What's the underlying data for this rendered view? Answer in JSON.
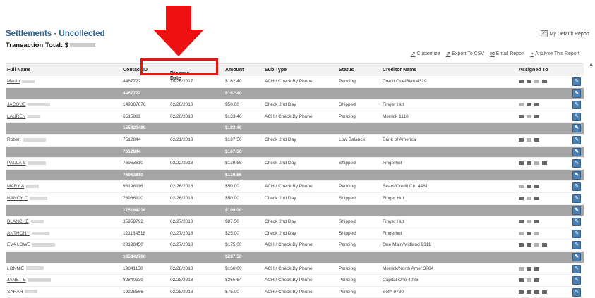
{
  "header": {
    "title": "Settlements - Uncollected",
    "total_label": "Transaction Total: $",
    "my_default_report": "My Default Report",
    "my_default_checked": true
  },
  "toolbar": {
    "customize": "Customize",
    "export_csv": "Export To CSV",
    "email_report": "Email Report",
    "analyze_report": "Analyze This Report"
  },
  "columns": {
    "full_name": "Full Name",
    "contact_id": "Contact ID",
    "process_date": "Process Date",
    "amount": "Amount",
    "sub_type": "Sub Type",
    "status": "Status",
    "creditor_name": "Creditor Name",
    "assigned_to": "Assigned To"
  },
  "rows": [
    {
      "type": "data",
      "name": "Martin",
      "contact": "4467722",
      "date": "10/26/2017",
      "amount": "$162.40",
      "sub": "ACH / Check By Phone",
      "status": "Pending",
      "creditor": "Credit One/Blatt 4329"
    },
    {
      "type": "sub",
      "contact": "4467722",
      "amount": "$162.40"
    },
    {
      "type": "data",
      "name": "JACQUE",
      "contact": "149307878",
      "date": "02/20/2018",
      "amount": "$50.00",
      "sub": "Check 2nd Day",
      "status": "Shipped",
      "creditor": "Finger Hut"
    },
    {
      "type": "data",
      "name": "LAUREN",
      "contact": "6515811",
      "date": "02/20/2018",
      "amount": "$133.46",
      "sub": "ACH / Check By Phone",
      "status": "Pending",
      "creditor": "Merrick 1110"
    },
    {
      "type": "sub",
      "contact": "155823489",
      "amount": "$183.46"
    },
    {
      "type": "data",
      "name": "Robert",
      "contact": "7512844",
      "date": "02/21/2018",
      "amount": "$187.50",
      "sub": "Check 2nd Day",
      "status": "Low Balance",
      "creditor": "Bank of America"
    },
    {
      "type": "sub",
      "contact": "7512844",
      "amount": "$187.50"
    },
    {
      "type": "data",
      "name": "PAULA S",
      "contact": "76963810",
      "date": "02/22/2018",
      "amount": "$139.66",
      "sub": "Check 2nd Day",
      "status": "Shipped",
      "creditor": "Fingerhut"
    },
    {
      "type": "sub",
      "contact": "76963810",
      "amount": "$139.66"
    },
    {
      "type": "data",
      "name": "MARY A",
      "contact": "98198116",
      "date": "02/26/2018",
      "amount": "$50.00",
      "sub": "ACH / Check By Phone",
      "status": "Pending",
      "creditor": "Sears/Credit Ctrl 4481"
    },
    {
      "type": "data",
      "name": "NANCY C",
      "contact": "76966120",
      "date": "02/26/2018",
      "amount": "$50.00",
      "sub": "Check 2nd Day",
      "status": "Shipped",
      "creditor": "Finger Hut"
    },
    {
      "type": "sub",
      "contact": "175164236",
      "amount": "$100.00"
    },
    {
      "type": "data",
      "name": "BLANCHE",
      "contact": "35959792",
      "date": "02/27/2018",
      "amount": "$87.50",
      "sub": "Check 2nd Day",
      "status": "Shipped",
      "creditor": "Finger Hut"
    },
    {
      "type": "data",
      "name": "ANTHONY",
      "contact": "121184518",
      "date": "02/27/2018",
      "amount": "$25.00",
      "sub": "Check 2nd Day",
      "status": "Shipped",
      "creditor": "Fingerhut"
    },
    {
      "type": "data",
      "name": "EVA LOWE",
      "contact": "28198450",
      "date": "02/27/2018",
      "amount": "$175.00",
      "sub": "ACH / Check By Phone",
      "status": "Pending",
      "creditor": "One Main/Midland 9311"
    },
    {
      "type": "sub",
      "contact": "185342760",
      "amount": "$287.50"
    },
    {
      "type": "data",
      "name": "LONNIE",
      "contact": "19841130",
      "date": "02/28/2018",
      "amount": "$150.00",
      "sub": "ACH / Check By Phone",
      "status": "Pending",
      "creditor": "Merrick/North Amer 3784"
    },
    {
      "type": "data",
      "name": "JANET E",
      "contact": "82840239",
      "date": "02/28/2018",
      "amount": "$265.64",
      "sub": "ACH / Check By Phone",
      "status": "Pending",
      "creditor": "Capital One 4086"
    },
    {
      "type": "data",
      "name": "SARAH",
      "contact": "19228566",
      "date": "02/28/2018",
      "amount": "$75.00",
      "sub": "ACH / Check By Phone",
      "status": "Pending",
      "creditor": "BofA 9730"
    }
  ]
}
